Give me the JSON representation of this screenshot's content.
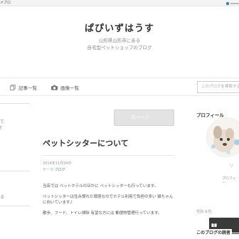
{
  "topbar": {
    "brand": "メブロ"
  },
  "blog": {
    "title": "ぱぴいずはうす",
    "desc_line1": "山形県山形市にある",
    "desc_line2": "自宅型ペットショップのブログ"
  },
  "nav": {
    "articles": "記事一覧",
    "images": "画像一覧",
    "search_placeholder": "このブログを検索する"
  },
  "left": {
    "t1": "て",
    "t2": "f",
    "t3": "る"
  },
  "pager": {
    "next": "次ページ"
  },
  "post": {
    "title": "ペットシッターについて",
    "date": "2014年11月24日",
    "theme_label": "テーマ:",
    "theme_link": "ブログ",
    "p1": "当店では ペットホテルのほかに ペットシッターも行っています。",
    "p2": "ペットシッターは住み慣れた環境なのでホテル利用で負担の多い 猫ちゃん に向いています♪",
    "p3": "散歩、フード、トイレ掃除 有望な方には 郵便物管理行っています。"
  },
  "sidebar": {
    "profile_heading": "プロフィール",
    "profile_name": "リ",
    "profile_link": "プロフィー",
    "gender_label": "性別:女性",
    "settings_heading": "このブログの読者"
  },
  "colors": {
    "accent_link": "#4a7fc1",
    "reader_button": "#3a3a3a"
  }
}
